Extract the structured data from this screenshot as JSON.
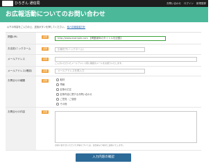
{
  "header": {
    "brand": "ひろぎん 通信局",
    "nav": [
      "お問い合わせ",
      "ログイン",
      "新規登録"
    ]
  },
  "banner": {
    "title": "お広報活動についてのお問い合わせ"
  },
  "notice": {
    "text": "以下の内容をご入力の上、送信ボタンを押してください。",
    "link": "個人情報保護方針"
  },
  "form": {
    "required_badge": "必須",
    "fields": {
      "url": {
        "label": "掲載URL",
        "value": "http://www.example.com 【掲載媒体のタイトルを記載】"
      },
      "name": {
        "label": "お名前/ニックネーム",
        "placeholder": "広報花子(ニックネーム)"
      },
      "email": {
        "label": "メールアドレス",
        "placeholder": "",
        "help": "ご入力いただいたメールアドレス宛に確認のメールをお送りいたします。"
      },
      "email_confirm": {
        "label": "メールアドレス(確認)",
        "placeholder": "メールアドレスを再入力"
      },
      "type": {
        "label": "お問合せの種類",
        "options": [
          "取材",
          "寄稿",
          "記事の訂正",
          "記事内容に関するお問い合わせ",
          "ご意見・ご感想",
          "その他"
        ]
      },
      "content": {
        "label": "お問合せの内容",
        "note": "お問い合わせいただいた内容については、担当者より順次ご連絡いたします。"
      }
    }
  },
  "submit": {
    "label": "入力内容の確認"
  }
}
